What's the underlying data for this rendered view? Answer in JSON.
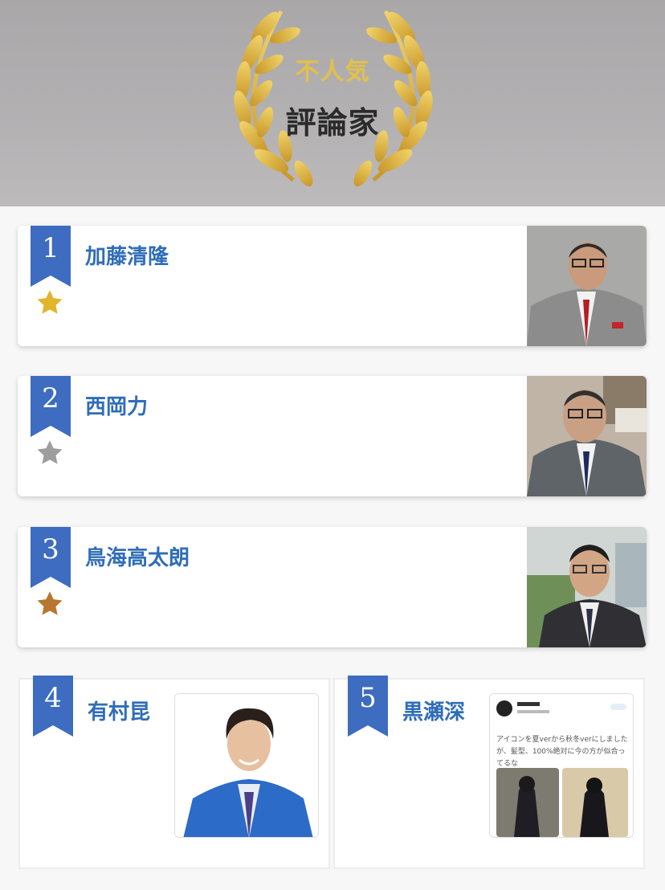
{
  "header": {
    "subtitle": "不人気",
    "title": "評論家"
  },
  "ranking": [
    {
      "rank": "1",
      "name": "加藤清隆",
      "star": "gold"
    },
    {
      "rank": "2",
      "name": "西岡力",
      "star": "silver"
    },
    {
      "rank": "3",
      "name": "鳥海高太朗",
      "star": "bronze"
    },
    {
      "rank": "4",
      "name": "有村昆"
    },
    {
      "rank": "5",
      "name": "黒瀬深"
    }
  ],
  "tweet": {
    "text": "アイコンを夏verから秋冬verにしましたが、髪型、100%絶対に今の方が似合ってるな"
  },
  "colors": {
    "ribbon": "#3d6cc0",
    "gold_star": "#e2b52a",
    "silver_star": "#9e9e9e",
    "bronze_star": "#b8762f",
    "name": "#2f6db8",
    "wreath": "#d9b23a"
  },
  "icons": [
    "laurel-wreath-icon",
    "ribbon-badge-icon",
    "star-icon"
  ]
}
